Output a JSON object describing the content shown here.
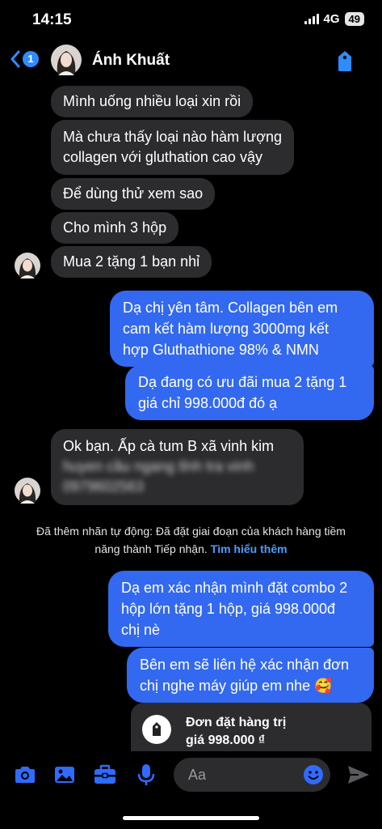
{
  "status_bar": {
    "time": "14:15",
    "network": "4G",
    "battery": "49"
  },
  "header": {
    "back_count": "1",
    "contact_name": "Ánh Khuất"
  },
  "messages": [
    {
      "from": "contact",
      "text": "Mình uống nhiều loại xin rồi"
    },
    {
      "from": "contact",
      "lines": [
        "Mà chưa thấy loại nào hàm lượng",
        "collagen với gluthation cao vậy"
      ]
    },
    {
      "from": "contact",
      "text": "Để dùng thử xem sao"
    },
    {
      "from": "contact",
      "text": "Cho mình 3 hộp"
    },
    {
      "from": "contact",
      "text": "Mua 2 tặng 1 bạn nhỉ"
    },
    {
      "from": "me",
      "lines": [
        "Dạ chị yên tâm. Collagen bên em",
        "cam kết hàm lượng 3000mg kết",
        "hợp Gluthathione 98% & NMN"
      ]
    },
    {
      "from": "me",
      "lines": [
        "Dạ đang có ưu đãi mua 2 tặng 1",
        "giá chỉ 998.000đ đó ạ"
      ]
    },
    {
      "from": "contact",
      "lines": [
        "Ok bạn. Ấp cà tum B xã vinh kim",
        "huyen cầu ngang tỉnh tra vinh",
        "0979602563"
      ]
    },
    {
      "from": "me",
      "lines": [
        "Dạ em xác nhận mình đặt combo 2",
        "hộp lớn tặng 1 hộp, giá 998.000đ",
        "chị nè"
      ]
    },
    {
      "from": "me",
      "lines": [
        "Bên em sẽ liên hệ xác nhận đơn",
        "chị nghe máy giúp em nhe 🥰"
      ]
    }
  ],
  "system_notice": {
    "line1": "Đã thêm nhãn tự động: Đã đặt giai đoạn của khách hàng tiềm",
    "line2": "năng thành Tiếp nhận.",
    "link": "Tìm hiểu thêm"
  },
  "order_card": {
    "title": "Đơn đặt hàng trị",
    "price": "giá 998.000 ₫"
  },
  "composer": {
    "placeholder": "Aa",
    "icons": [
      "camera-icon",
      "image-icon",
      "briefcase-icon",
      "microphone-icon",
      "emoji-icon",
      "send-icon"
    ]
  },
  "colors": {
    "accent": "#3369f0",
    "link": "#4a9eff",
    "incoming_bubble": "#2c2c2e",
    "background": "#000000"
  }
}
